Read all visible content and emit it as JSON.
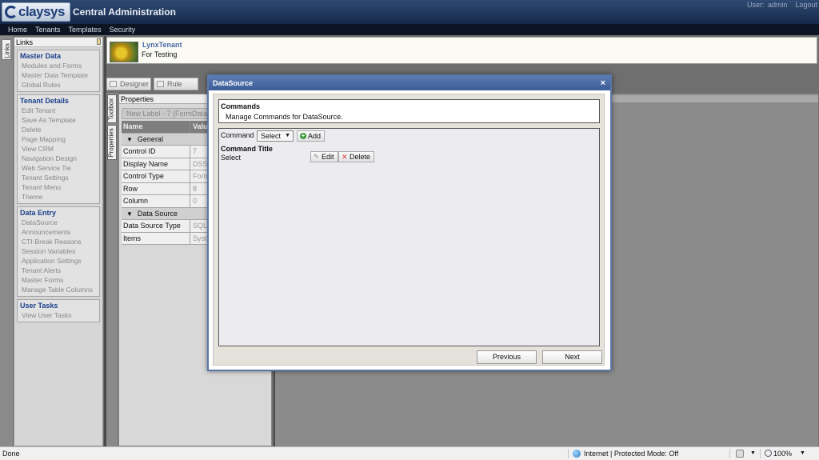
{
  "header": {
    "logo_text": "claysys",
    "app_title": "Central Administration",
    "user_label": "User: admin",
    "logout_label": "Logout"
  },
  "nav": [
    "Home",
    "Tenants",
    "Templates",
    "Security"
  ],
  "left_tab": "Links",
  "links_panel": {
    "title": "Links",
    "groups": [
      {
        "title": "Master Data",
        "items": [
          "Modules and Forms",
          "Master Data Template",
          "Global Rules"
        ]
      },
      {
        "title": "Tenant Details",
        "items": [
          "Edit Tenant",
          "Save As Template",
          "Delete",
          "Page Mapping",
          "View CRM",
          "Navigation Design",
          "Web Service Tie",
          "Tenant Settings",
          "Tenant Menu",
          "Theme"
        ]
      },
      {
        "title": "Data Entry",
        "items": [
          "DataSource",
          "Announcements",
          "CTI-Break Reasons",
          "Session Variables",
          "Application Settings",
          "Tenant Alerts",
          "Master Forms",
          "Manage Table Columns"
        ]
      },
      {
        "title": "User Tasks",
        "items": [
          "View User Tasks"
        ]
      }
    ]
  },
  "tenant": {
    "name": "LynxTenant",
    "description": "For Testing"
  },
  "toolbar": {
    "designer": "Designer",
    "rule": "Rule"
  },
  "side_tabs": {
    "toolbox": "Toolbox",
    "properties": "Properties"
  },
  "properties": {
    "title": "Properties",
    "selected": "New Label - 7 (FormData",
    "col_name": "Name",
    "col_value": "Valu",
    "sections": [
      {
        "title": "General",
        "rows": [
          {
            "name": "Control ID",
            "value": "7"
          },
          {
            "name": "Display Name",
            "value": "DSSe"
          },
          {
            "name": "Control Type",
            "value": "Form"
          },
          {
            "name": "Row",
            "value": "8"
          },
          {
            "name": "Column",
            "value": "0"
          }
        ]
      },
      {
        "title": "Data Source",
        "rows": [
          {
            "name": "Data Source Type",
            "value": "SQL"
          },
          {
            "name": "Items",
            "value": "Syst"
          }
        ]
      }
    ]
  },
  "modal": {
    "title": "DataSource",
    "close": "×",
    "commands_title": "Commands",
    "commands_desc": "Manage Commands for DataSource.",
    "command_label": "Command",
    "command_select": "Select",
    "add_label": "Add",
    "command_title_label": "Command Title",
    "command_value": "Select",
    "edit_label": "Edit",
    "delete_label": "Delete",
    "previous_label": "Previous",
    "next_label": "Next"
  },
  "status": {
    "left": "Done",
    "zone": "Internet | Protected Mode: Off",
    "zoom": "100%"
  }
}
